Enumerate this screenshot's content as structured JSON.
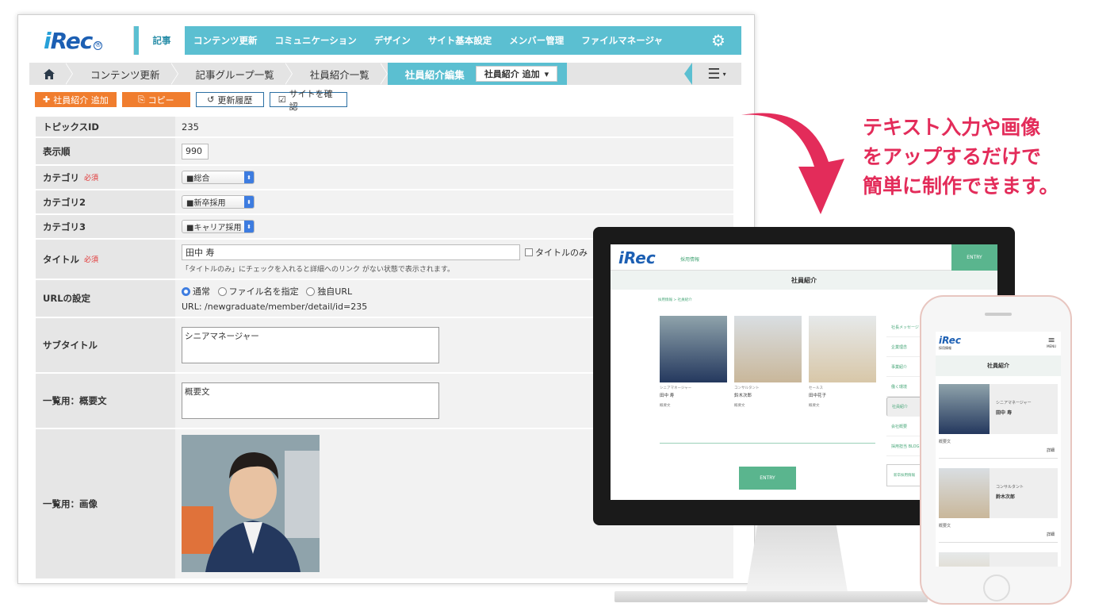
{
  "logo": {
    "main": "Rec",
    "prefix": "i",
    "mark": "®"
  },
  "nav": {
    "items": [
      "記事",
      "コンテンツ更新",
      "コミュニケーション",
      "デザイン",
      "サイト基本設定",
      "メンバー管理",
      "ファイルマネージャ"
    ],
    "active_index": 0,
    "settings_icon": "gear-icon"
  },
  "breadcrumb": {
    "items": [
      "コンテンツ更新",
      "記事グループ一覧",
      "社員紹介一覧"
    ],
    "current": "社員紹介編集",
    "select_label": "社員紹介 追加",
    "menu_icon": "hamburger-icon"
  },
  "actions": {
    "add": "社員紹介 追加",
    "copy": "コピー",
    "history": "更新履歴",
    "confirm": "サイトを確認"
  },
  "form": {
    "topics_id": {
      "label": "トピックスID",
      "value": "235"
    },
    "order": {
      "label": "表示順",
      "value": "990"
    },
    "category": {
      "label": "カテゴリ",
      "required": "必須",
      "value": "■総合"
    },
    "category2": {
      "label": "カテゴリ2",
      "value": "■新卒採用"
    },
    "category3": {
      "label": "カテゴリ3",
      "value": "■キャリア採用"
    },
    "title": {
      "label": "タイトル",
      "required": "必須",
      "value": "田中 寿",
      "checkbox": "タイトルのみ",
      "help": "「タイトルのみ」にチェックを入れると詳細へのリンク がない状態で表示されます。"
    },
    "url": {
      "label": "URLの設定",
      "options": [
        "通常",
        "ファイル名を指定",
        "独自URL"
      ],
      "selected": 0,
      "value": "URL: /newgraduate/member/detail/id=235"
    },
    "subtitle": {
      "label": "サブタイトル",
      "value": "シニアマネージャー"
    },
    "summary": {
      "label": "一覧用：概要文",
      "value": "概要文"
    },
    "image": {
      "label": "一覧用：画像"
    }
  },
  "headline": [
    "テキスト入力や画像",
    "をアップするだけで",
    "簡単に制作できます。"
  ],
  "desktop": {
    "logo": "iRec",
    "subtitle": "採用情報",
    "entry": "ENTRY",
    "title": "社員紹介",
    "crumb": "採用情報 > 社員紹介",
    "cards": [
      {
        "role": "シニアマネージャー",
        "name": "田中 寿",
        "desc": "概要文"
      },
      {
        "role": "コンサルタント",
        "name": "鈴木次郎",
        "desc": "概要文"
      },
      {
        "role": "セールス",
        "name": "田中花子",
        "desc": "概要文"
      }
    ],
    "sidebar": [
      "社長メッセージ",
      "企業理念",
      "事業紹介",
      "働く環境",
      "社員紹介",
      "会社概要",
      "採用担当 BLOG"
    ],
    "sidebar_box": "新卒採用情報",
    "entry_bottom": "ENTRY"
  },
  "phone": {
    "logo": "iRec",
    "logo_sub": "採用情報",
    "menu": "MENU",
    "title": "社員紹介",
    "cards": [
      {
        "role": "シニアマネージャー",
        "name": "田中 寿",
        "desc": "概要文",
        "more": "詳細"
      },
      {
        "role": "コンサルタント",
        "name": "鈴木次郎",
        "desc": "概要文",
        "more": "詳細"
      }
    ]
  },
  "colors": {
    "nav": "#5bbfd1",
    "orange": "#f07d2e",
    "accent": "#e32c5a",
    "green": "#5ab58e"
  }
}
